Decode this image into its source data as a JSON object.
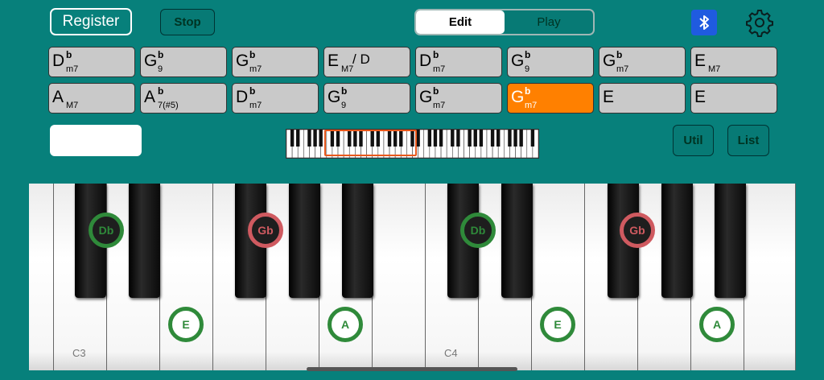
{
  "toolbar": {
    "register_label": "Register",
    "stop_label": "Stop",
    "mode_tabs": [
      "Edit",
      "Play"
    ],
    "active_mode": "Edit",
    "util_label": "Util",
    "list_label": "List"
  },
  "chords": [
    {
      "root": "D",
      "acc": "b",
      "qual": "m7",
      "bass": ""
    },
    {
      "root": "G",
      "acc": "b",
      "qual": "9",
      "bass": ""
    },
    {
      "root": "G",
      "acc": "b",
      "qual": "m7",
      "bass": ""
    },
    {
      "root": "E",
      "acc": "",
      "qual": "M7",
      "bass": "/ D"
    },
    {
      "root": "D",
      "acc": "b",
      "qual": "m7",
      "bass": ""
    },
    {
      "root": "G",
      "acc": "b",
      "qual": "9",
      "bass": ""
    },
    {
      "root": "G",
      "acc": "b",
      "qual": "m7",
      "bass": ""
    },
    {
      "root": "E",
      "acc": "",
      "qual": "M7",
      "bass": ""
    },
    {
      "root": "A",
      "acc": "",
      "qual": "M7",
      "bass": ""
    },
    {
      "root": "A",
      "acc": "b",
      "qual": "7(#5)",
      "bass": ""
    },
    {
      "root": "D",
      "acc": "b",
      "qual": "m7",
      "bass": ""
    },
    {
      "root": "G",
      "acc": "b",
      "qual": "9",
      "bass": ""
    },
    {
      "root": "G",
      "acc": "b",
      "qual": "m7",
      "bass": ""
    },
    {
      "root": "G",
      "acc": "b",
      "qual": "m7",
      "bass": "",
      "active": true
    },
    {
      "root": "E",
      "acc": "",
      "qual": "",
      "bass": ""
    },
    {
      "root": "E",
      "acc": "",
      "qual": "",
      "bass": ""
    }
  ],
  "piano": {
    "octave_labels": [
      "C3",
      "C4"
    ],
    "markers": [
      "Db",
      "Gb",
      "E",
      "A",
      "Db",
      "Gb",
      "E",
      "A"
    ]
  },
  "colors": {
    "background": "#07807b",
    "active_chord": "#ff8000",
    "root_marker": "#2f8a3a",
    "other_marker": "#cf5a60"
  }
}
